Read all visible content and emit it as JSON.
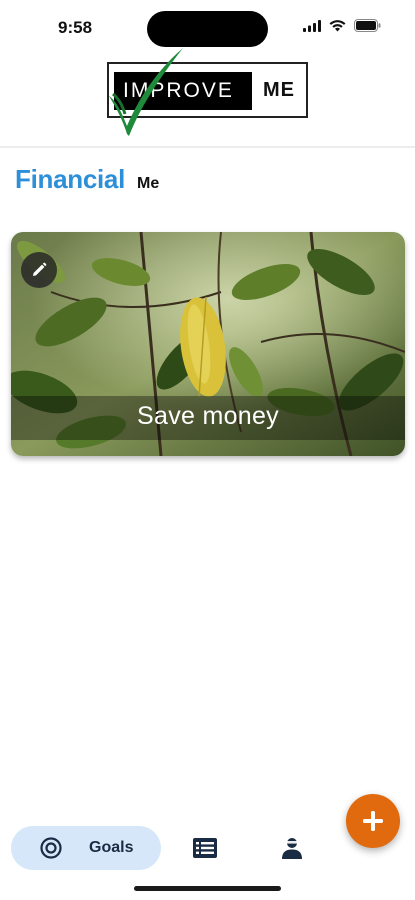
{
  "status_bar": {
    "time": "9:58",
    "icons": [
      "signal-icon",
      "wifi-icon",
      "battery-icon"
    ]
  },
  "logo": {
    "word1": "IMPROVE",
    "word2": "ME",
    "check_color": "#1f8a3a"
  },
  "page": {
    "title": "Financial",
    "subtitle": "Me",
    "title_color": "#2d8fd8"
  },
  "goals": [
    {
      "label": "Save money",
      "edit_icon": "pencil-icon"
    }
  ],
  "fab": {
    "label": "+",
    "color": "#e06a0d"
  },
  "bottom_nav": {
    "items": [
      {
        "id": "goals",
        "label": "Goals",
        "icon": "target-icon",
        "active": true
      },
      {
        "id": "list",
        "label": "",
        "icon": "list-icon",
        "active": false
      },
      {
        "id": "profile",
        "label": "",
        "icon": "person-icon",
        "active": false
      }
    ],
    "active_bg": "#d5e7f8"
  }
}
